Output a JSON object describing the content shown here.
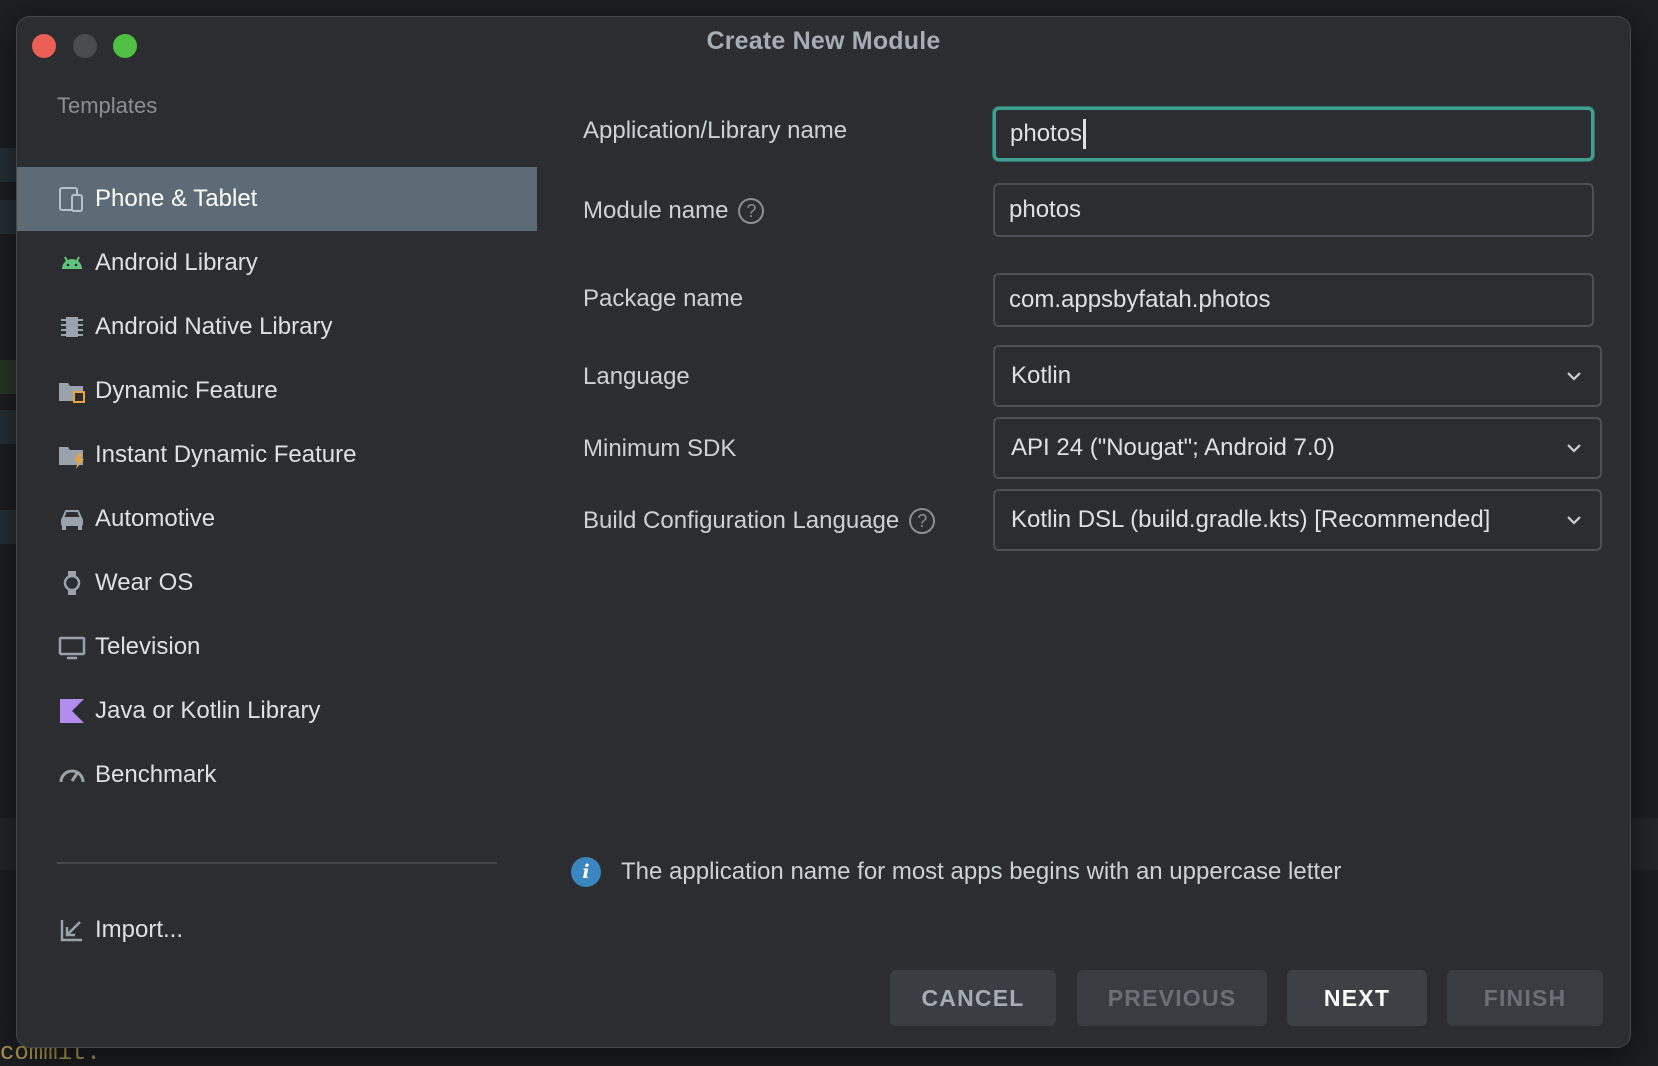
{
  "dialog": {
    "title": "Create New Module"
  },
  "sidebar": {
    "heading": "Templates",
    "items": [
      {
        "label": "Phone & Tablet",
        "icon": "phone-tablet-icon",
        "selected": true
      },
      {
        "label": "Android Library",
        "icon": "android-icon"
      },
      {
        "label": "Android Native Library",
        "icon": "native-chip-icon"
      },
      {
        "label": "Dynamic Feature",
        "icon": "folder-module-icon"
      },
      {
        "label": "Instant Dynamic Feature",
        "icon": "folder-lightning-icon"
      },
      {
        "label": "Automotive",
        "icon": "car-icon"
      },
      {
        "label": "Wear OS",
        "icon": "watch-icon"
      },
      {
        "label": "Television",
        "icon": "tv-icon"
      },
      {
        "label": "Java or Kotlin Library",
        "icon": "kotlin-icon"
      },
      {
        "label": "Benchmark",
        "icon": "gauge-icon"
      }
    ],
    "import_label": "Import..."
  },
  "form": {
    "app_name": {
      "label": "Application/Library name",
      "value": "photos"
    },
    "module_name": {
      "label": "Module name",
      "value": "photos"
    },
    "package_name": {
      "label": "Package name",
      "value": "com.appsbyfatah.photos"
    },
    "language": {
      "label": "Language",
      "value": "Kotlin"
    },
    "min_sdk": {
      "label": "Minimum SDK",
      "value": "API 24 (\"Nougat\"; Android 7.0)"
    },
    "build_config": {
      "label": "Build Configuration Language",
      "value": "Kotlin DSL (build.gradle.kts) [Recommended]"
    },
    "help_glyph": "?"
  },
  "info": {
    "text": "The application name for most apps begins with an uppercase letter",
    "glyph": "i"
  },
  "buttons": {
    "cancel": "CANCEL",
    "previous": "PREVIOUS",
    "next": "NEXT",
    "finish": "FINISH"
  },
  "background": {
    "commit_text": "commit."
  },
  "colors": {
    "accent_focus": "#3f9f93",
    "selected_bg": "#5c6b76",
    "info_blue": "#3a86c0"
  }
}
